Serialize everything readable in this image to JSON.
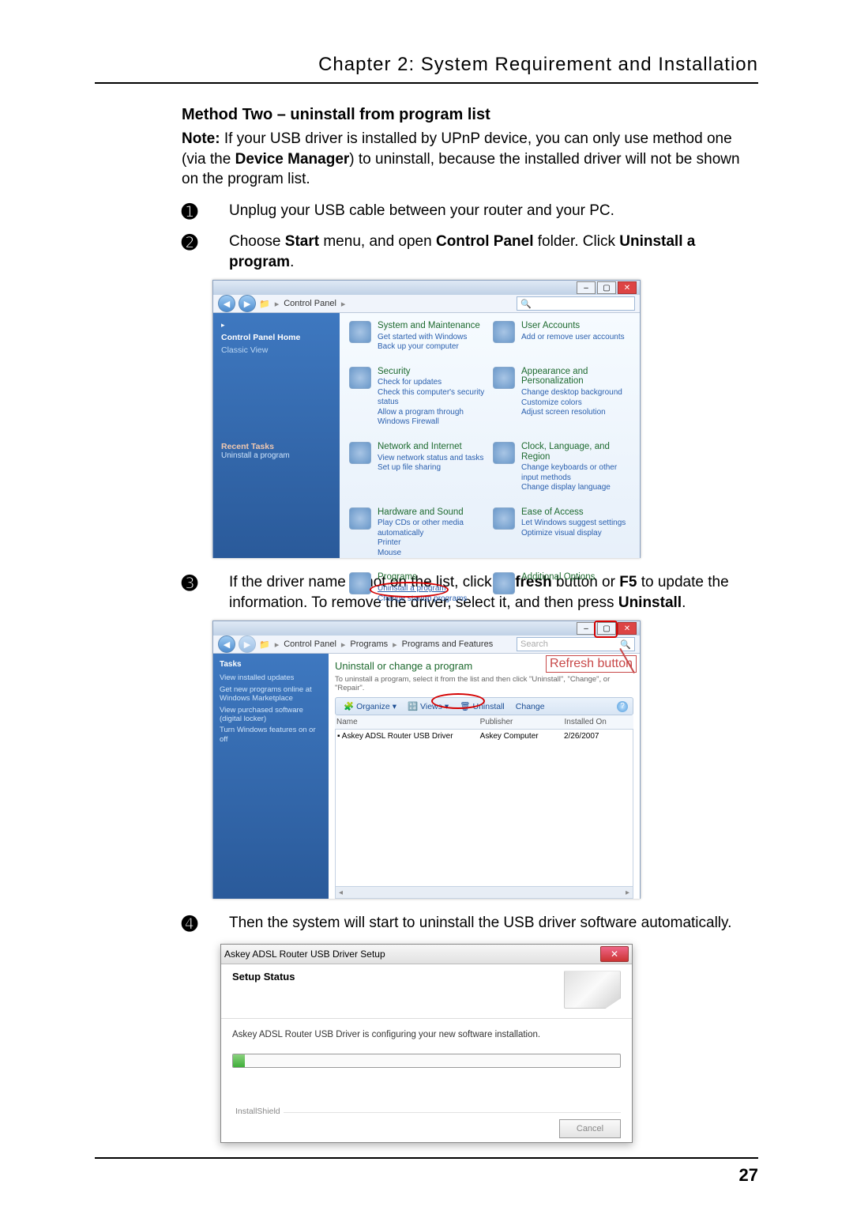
{
  "header": {
    "chapter_title": "Chapter 2: System Requirement and Installation"
  },
  "page_number": "27",
  "method": {
    "heading": "Method Two – uninstall from program list",
    "note_prefix": "Note:",
    "note_body": " If your USB driver is installed by UPnP device, you can only use method one (via the ",
    "note_bold1": "Device Manager",
    "note_body2": ") to uninstall, because the installed driver will not be shown on the program list."
  },
  "steps": {
    "s1": {
      "num": "➊",
      "text": "Unplug your USB cable between your router and your PC."
    },
    "s2": {
      "num": "➋",
      "t1": "Choose ",
      "b1": "Start",
      "t2": " menu, and open ",
      "b2": "Control Panel",
      "t3": " folder. Click ",
      "b3": "Uninstall a program",
      "t4": "."
    },
    "s3": {
      "num": "➌",
      "t1": "If the driver name is not on the list, click ",
      "b1": "Refresh",
      "t2": " button or ",
      "b2": "F5",
      "t3": " to update the information. To remove the driver, select it, and then press ",
      "b3": "Uninstall",
      "t4": "."
    },
    "s4": {
      "num": "➍",
      "text": "Then the system will start to uninstall the USB driver software automatically."
    }
  },
  "fig1": {
    "breadcrumb": "Control Panel",
    "sidebar": {
      "home": "Control Panel Home",
      "classic": "Classic View",
      "recent_tasks": "Recent Tasks",
      "recent_item": "Uninstall a program"
    },
    "cats": {
      "sys": {
        "title": "System and Maintenance",
        "l1": "Get started with Windows",
        "l2": "Back up your computer"
      },
      "ua": {
        "title": "User Accounts",
        "l1": "Add or remove user accounts"
      },
      "sec": {
        "title": "Security",
        "l1": "Check for updates",
        "l2": "Check this computer's security status",
        "l3": "Allow a program through Windows Firewall"
      },
      "ap": {
        "title": "Appearance and Personalization",
        "l1": "Change desktop background",
        "l2": "Customize colors",
        "l3": "Adjust screen resolution"
      },
      "net": {
        "title": "Network and Internet",
        "l1": "View network status and tasks",
        "l2": "Set up file sharing"
      },
      "clk": {
        "title": "Clock, Language, and Region",
        "l1": "Change keyboards or other input methods",
        "l2": "Change display language"
      },
      "hw": {
        "title": "Hardware and Sound",
        "l1": "Play CDs or other media automatically",
        "l2": "Printer",
        "l3": "Mouse"
      },
      "ea": {
        "title": "Ease of Access",
        "l1": "Let Windows suggest settings",
        "l2": "Optimize visual display"
      },
      "prg": {
        "title": "Programs",
        "l1": "Uninstall a program",
        "l2": "Change startup programs"
      },
      "ao": {
        "title": "Additional Options"
      }
    }
  },
  "fig2": {
    "crumb1": "Control Panel",
    "crumb2": "Programs",
    "crumb3": "Programs and Features",
    "search_placeholder": "Search",
    "side": {
      "tasks": "Tasks",
      "l1": "View installed updates",
      "l2": "Get new programs online at Windows Marketplace",
      "l3": "View purchased software (digital locker)",
      "l4": "Turn Windows features on or off"
    },
    "main": {
      "h1": "Uninstall or change a program",
      "h2": "To uninstall a program, select it from the list and then click \"Uninstall\", \"Change\", or \"Repair\"."
    },
    "toolbar": {
      "organize": "Organize",
      "views": "Views",
      "uninstall": "Uninstall",
      "change": "Change"
    },
    "cols": {
      "name": "Name",
      "publisher": "Publisher",
      "installed": "Installed On"
    },
    "row": {
      "name": "Askey ADSL Router USB Driver",
      "publisher": "Askey Computer",
      "installed": "2/26/2007"
    },
    "callout": "Refresh button"
  },
  "fig3": {
    "title": "Askey ADSL Router USB Driver Setup",
    "status": "Setup Status",
    "msg": "Askey ADSL Router USB Driver is configuring your new software installation.",
    "group": "InstallShield",
    "cancel": "Cancel"
  }
}
